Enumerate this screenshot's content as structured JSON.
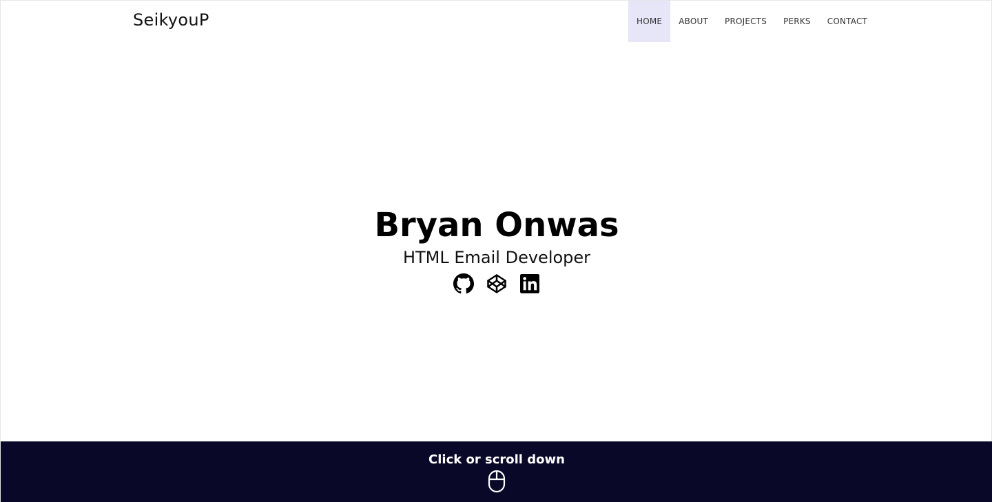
{
  "header": {
    "brand": "SeikyouP",
    "nav": [
      {
        "label": "HOME",
        "active": true
      },
      {
        "label": "ABOUT",
        "active": false
      },
      {
        "label": "PROJECTS",
        "active": false
      },
      {
        "label": "PERKS",
        "active": false
      },
      {
        "label": "CONTACT",
        "active": false
      }
    ]
  },
  "hero": {
    "name": "Bryan Onwas",
    "role": "HTML Email Developer",
    "socials": [
      "github-icon",
      "codepen-icon",
      "linkedin-icon"
    ]
  },
  "footer": {
    "cta": "Click or scroll down",
    "icon": "mouse-icon",
    "background": "#0a0828"
  },
  "colors": {
    "active_nav_bg": "#e6e6f8",
    "text": "#000000"
  }
}
